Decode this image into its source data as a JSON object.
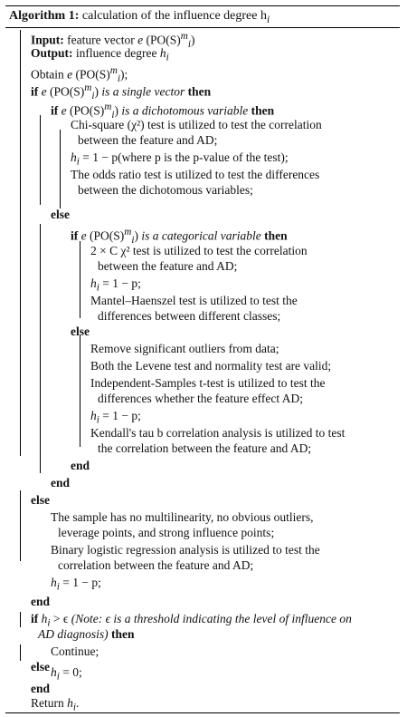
{
  "title": {
    "label": "Algorithm 1:",
    "text": "calculation of the influence degree h",
    "sub": "i"
  },
  "lines": [
    "Input:",
    "feature vector",
    "Output:",
    "influence degree",
    "Obtain",
    "if",
    "is a single vector",
    "then",
    "if",
    "is a dichotomous variable",
    "then",
    "Chi-square (χ²) test is utilized to test the correlation",
    "between the feature and AD;",
    "= 1 − p(where p is the p-value of the test);",
    "The odds ratio test is utilized to test the differences",
    "between the dichotomous variables;",
    "else",
    "if",
    "is a categorical variable",
    "then",
    "2 × C χ² test is utilized to test the correlation",
    "between the feature and AD;",
    "= 1 − p;",
    "Mantel–Haenszel test is utilized to test the",
    "differences between different classes;",
    "else",
    "Remove significant outliers from data;",
    "Both the Levene test and normality test are valid;",
    "Independent-Samples t-test is utilized to test the",
    "differences whether the feature effect AD;",
    "= 1 − p;",
    "Kendall's tau b correlation analysis is utilized to test",
    "the correlation between the feature and AD;",
    "end",
    "end",
    "else",
    "The sample has no multilinearity, no obvious outliers,",
    "leverage points, and strong influence points;",
    "Binary logistic regression analysis is utilized to test the",
    "correlation between the feature and AD;",
    "= 1 − p;",
    "end",
    "if",
    "> ϵ",
    "(Note: ϵ is a threshold indicating the level of influence on",
    "AD diagnosis)",
    "then",
    "Continue;",
    "else",
    "= 0;",
    "end",
    "Return",
    "."
  ],
  "math": {
    "e": "e",
    "PO": "(PO(S)",
    "m": "m",
    "i": "i",
    "h": "h",
    "close": ")"
  }
}
